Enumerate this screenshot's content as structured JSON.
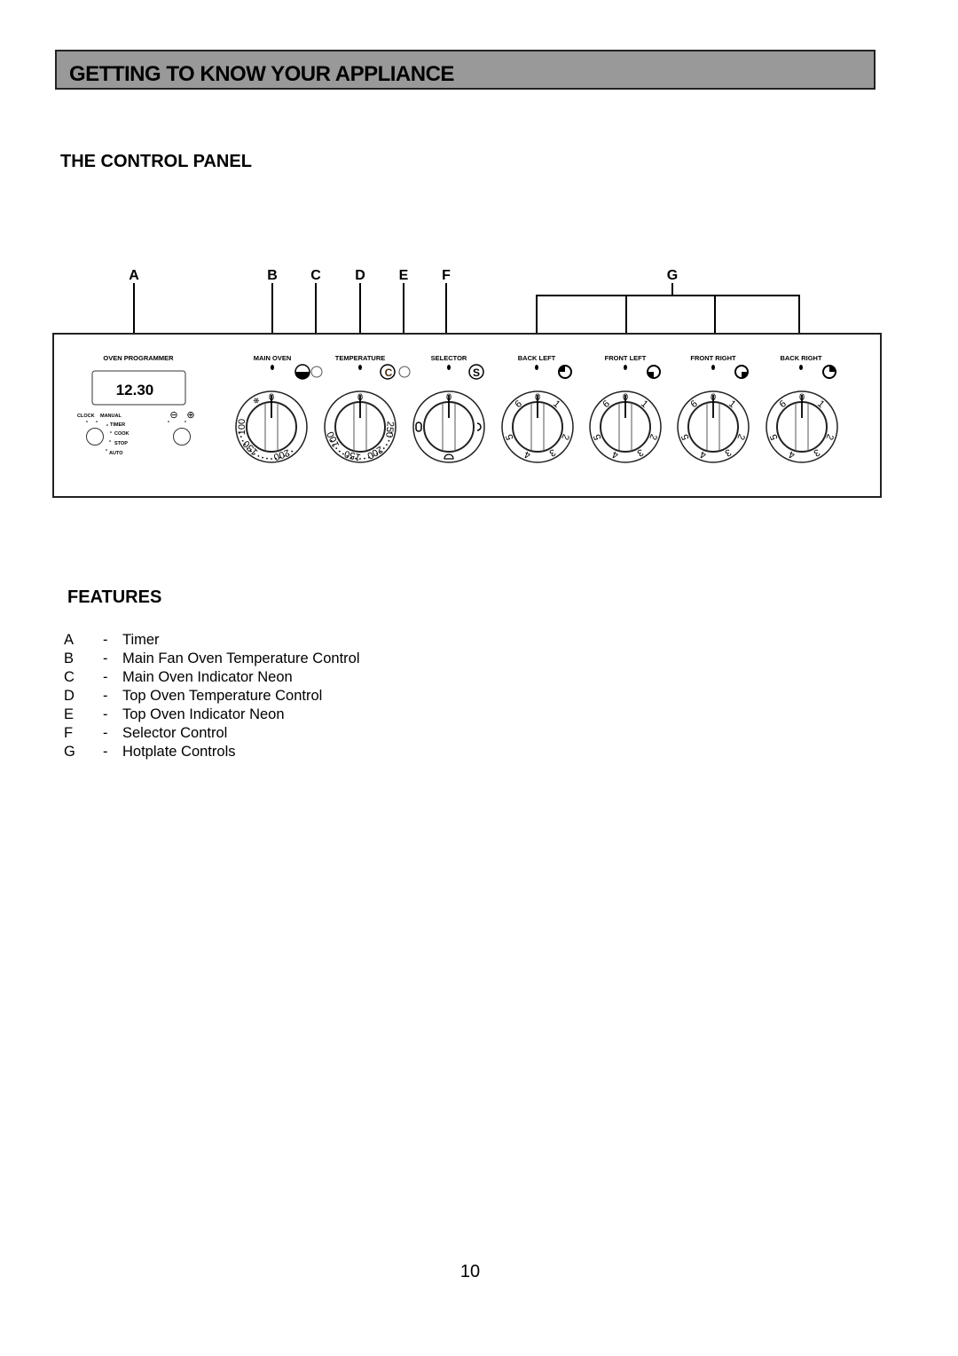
{
  "header": {
    "title": "GETTING TO KNOW YOUR APPLIANCE"
  },
  "control_panel": {
    "title": "THE CONTROL PANEL",
    "callouts": [
      "A",
      "B",
      "C",
      "D",
      "E",
      "F",
      "G"
    ],
    "programmer": {
      "label": "OVEN PROGRAMMER",
      "display": "12.30",
      "left_dial_labels": [
        "CLOCK",
        "MANUAL",
        "TIMER",
        "COOK",
        "STOP",
        "AUTO"
      ],
      "right_dial_labels": [
        "⊖",
        "⊕"
      ]
    },
    "oven_controls": [
      {
        "label": "MAIN OVEN",
        "icon": "main-oven-icon",
        "scale": [
          "0",
          "100",
          "150",
          "200"
        ],
        "neon": true
      },
      {
        "label": "TEMPERATURE",
        "icon": "celsius-icon",
        "icon_text": "C",
        "scale": [
          "0",
          "100",
          "150",
          "200",
          "250"
        ],
        "neon": true
      },
      {
        "label": "SELECTOR",
        "icon": "selector-icon",
        "icon_text": "S",
        "scale": [
          "0"
        ],
        "neon": false
      }
    ],
    "hotplates": [
      {
        "label": "BACK LEFT",
        "icon": "back-left-hotplate-icon"
      },
      {
        "label": "FRONT LEFT",
        "icon": "front-left-hotplate-icon"
      },
      {
        "label": "FRONT RIGHT",
        "icon": "front-right-hotplate-icon"
      },
      {
        "label": "BACK RIGHT",
        "icon": "back-right-hotplate-icon"
      }
    ],
    "hotplate_scale": [
      "0",
      "1",
      "2",
      "3",
      "4",
      "5",
      "6"
    ]
  },
  "features": {
    "title": "FEATURES",
    "items": [
      {
        "letter": "A",
        "dash": "-",
        "text": "Timer"
      },
      {
        "letter": "B",
        "dash": "-",
        "text": "Main Fan Oven Temperature Control"
      },
      {
        "letter": "C",
        "dash": "-",
        "text": "Main Oven Indicator Neon"
      },
      {
        "letter": "D",
        "dash": "-",
        "text": "Top Oven Temperature Control"
      },
      {
        "letter": "E",
        "dash": "-",
        "text": "Top Oven Indicator Neon"
      },
      {
        "letter": "F",
        "dash": "-",
        "text": "Selector Control"
      },
      {
        "letter": "G",
        "dash": "-",
        "text": "Hotplate Controls"
      }
    ]
  },
  "page_number": "10"
}
